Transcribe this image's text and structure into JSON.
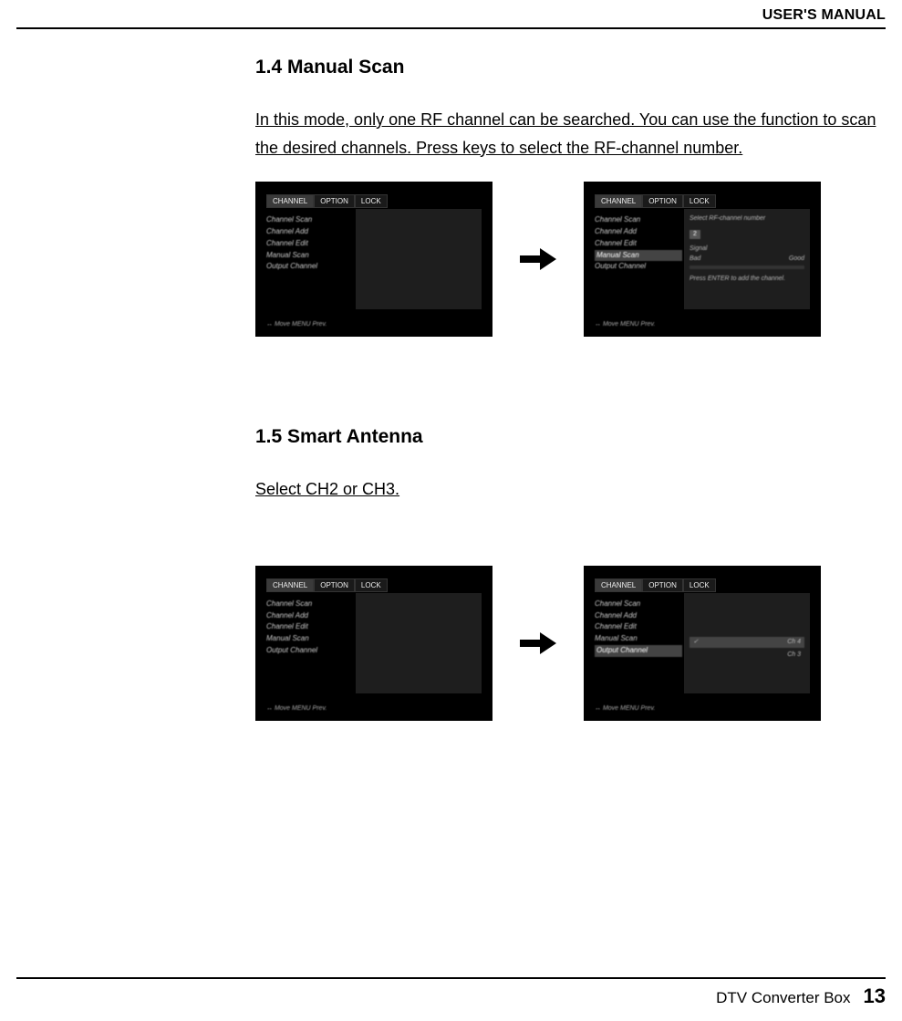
{
  "header": {
    "title": "USER'S MANUAL"
  },
  "footer": {
    "product": "DTV Converter Box",
    "page": "13"
  },
  "section1": {
    "heading": "1.4 Manual Scan",
    "body": "In this mode, only one RF channel can be searched. You can use the function to scan the desired channels. Press  keys to select the RF-channel number."
  },
  "section2": {
    "heading": "1.5 Smart Antenna",
    "body": "Select CH2 or CH3."
  },
  "tv_menu": {
    "tabs": [
      "CHANNEL",
      "OPTION",
      "LOCK"
    ],
    "items": [
      "Channel Scan",
      "Channel Add",
      "Channel Edit",
      "Manual Scan",
      "Output Channel"
    ],
    "hint": "↔ Move   MENU Prev."
  },
  "manual_scan_panel": {
    "title": "Select RF-channel number",
    "channel_value": "2",
    "signal_label": "Signal",
    "bad_label": "Bad",
    "good_label": "Good",
    "note": "Press ENTER to add the channel."
  },
  "output_panel": {
    "opt1": "Ch 4",
    "opt2": "Ch 3",
    "check": "✓"
  }
}
